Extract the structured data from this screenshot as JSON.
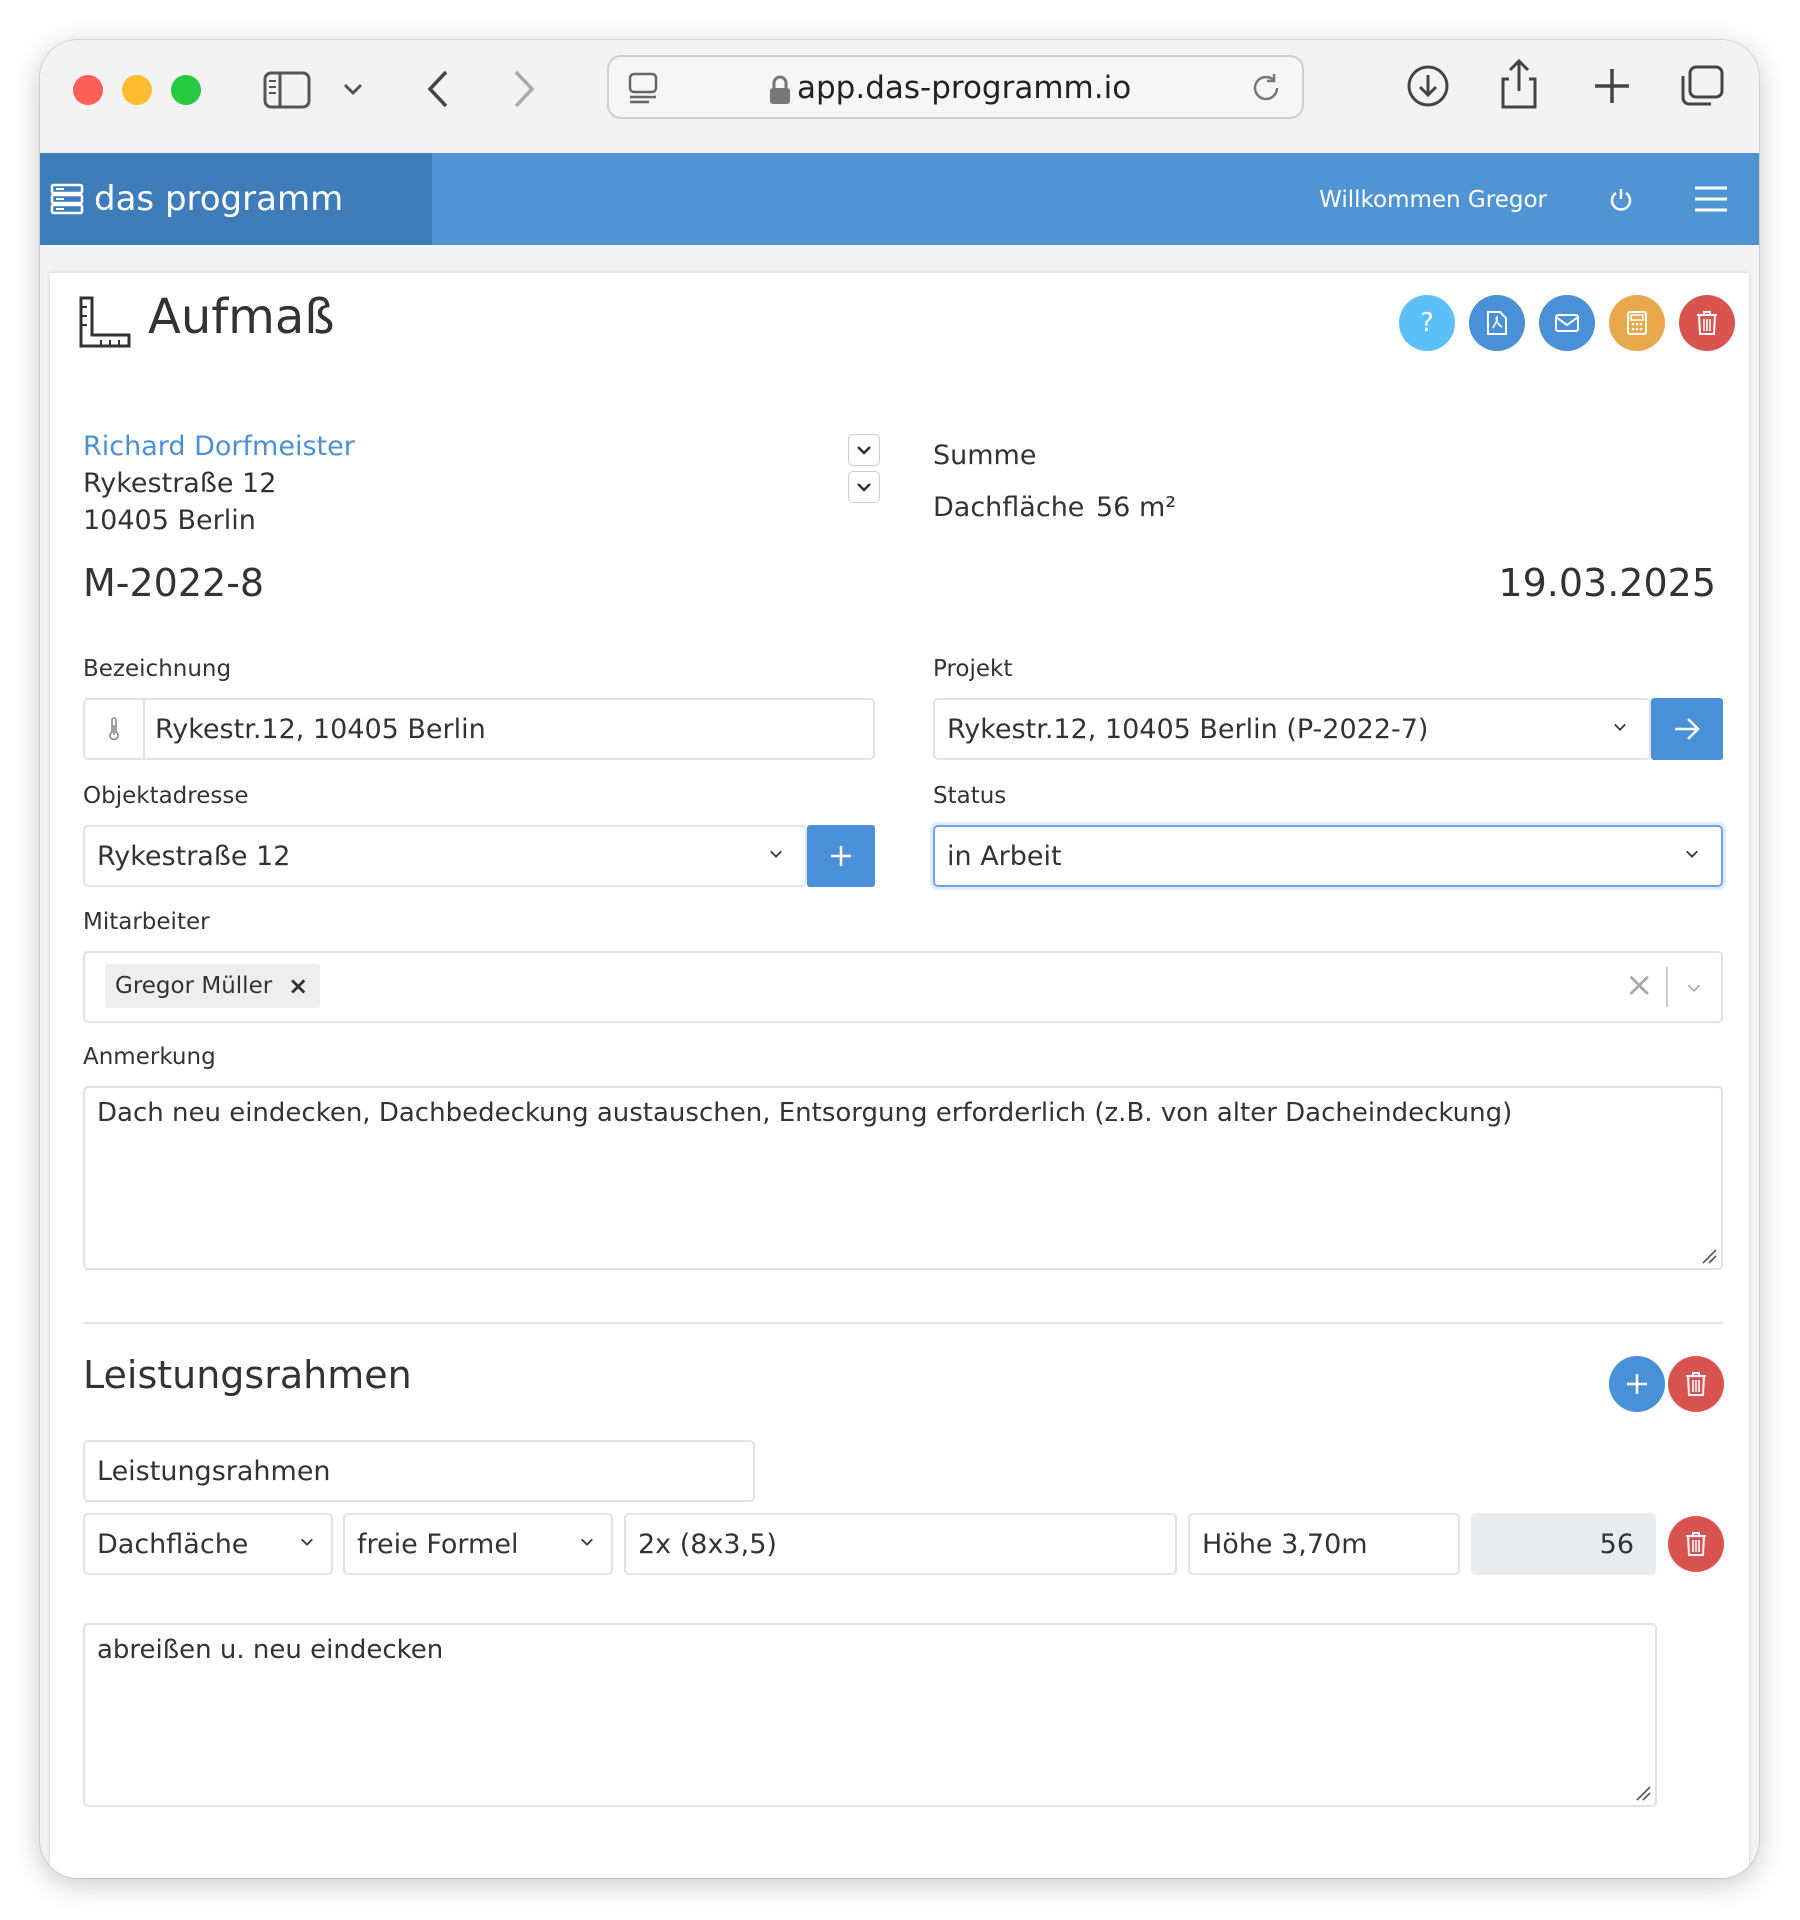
{
  "browser": {
    "url": "app.das-programm.io",
    "traffic_lights": {
      "close": "#fe5f57",
      "minimize": "#febc2e",
      "maximize": "#28c840"
    }
  },
  "app": {
    "brand": "das programm",
    "welcome": "Willkommen Gregor",
    "colors": {
      "navbar": "#5194d4",
      "brand_bg": "#3f7dba",
      "link": "#4a90d9",
      "danger": "#d9534f",
      "warning": "#e8a84c",
      "info": "#5bc0f7"
    }
  },
  "page": {
    "title": "Aufmaß",
    "action_buttons": [
      "help-icon",
      "pdf-icon",
      "mail-icon",
      "calculator-icon",
      "trash-icon"
    ],
    "customer": {
      "name": "Richard Dorfmeister",
      "street": "Rykestraße 12",
      "city": "10405 Berlin"
    },
    "summary": {
      "heading": "Summe",
      "label": "Dachfläche",
      "value": "56 m²"
    },
    "number": "M-2022-8",
    "date": "19.03.2025"
  },
  "form": {
    "bezeichnung": {
      "label": "Bezeichnung",
      "value": "Rykestr.12, 10405 Berlin"
    },
    "projekt": {
      "label": "Projekt",
      "value": "Rykestr.12, 10405 Berlin (P-2022-7)"
    },
    "objektadresse": {
      "label": "Objektadresse",
      "value": "Rykestraße 12"
    },
    "status": {
      "label": "Status",
      "value": "in Arbeit"
    },
    "mitarbeiter": {
      "label": "Mitarbeiter",
      "tags": [
        "Gregor Müller"
      ]
    },
    "anmerkung": {
      "label": "Anmerkung",
      "value": "Dach neu eindecken, Dachbedeckung austauschen, Entsorgung erforderlich (z.B. von alter Dacheindeckung)"
    }
  },
  "leistungsrahmen": {
    "heading": "Leistungsrahmen",
    "name_value": "Leistungsrahmen",
    "row": {
      "type": "Dachfläche",
      "mode": "freie Formel",
      "formula": "2x (8x3,5)",
      "note": "Höhe 3,70m",
      "result": "56"
    },
    "description": "abreißen u. neu eindecken"
  }
}
